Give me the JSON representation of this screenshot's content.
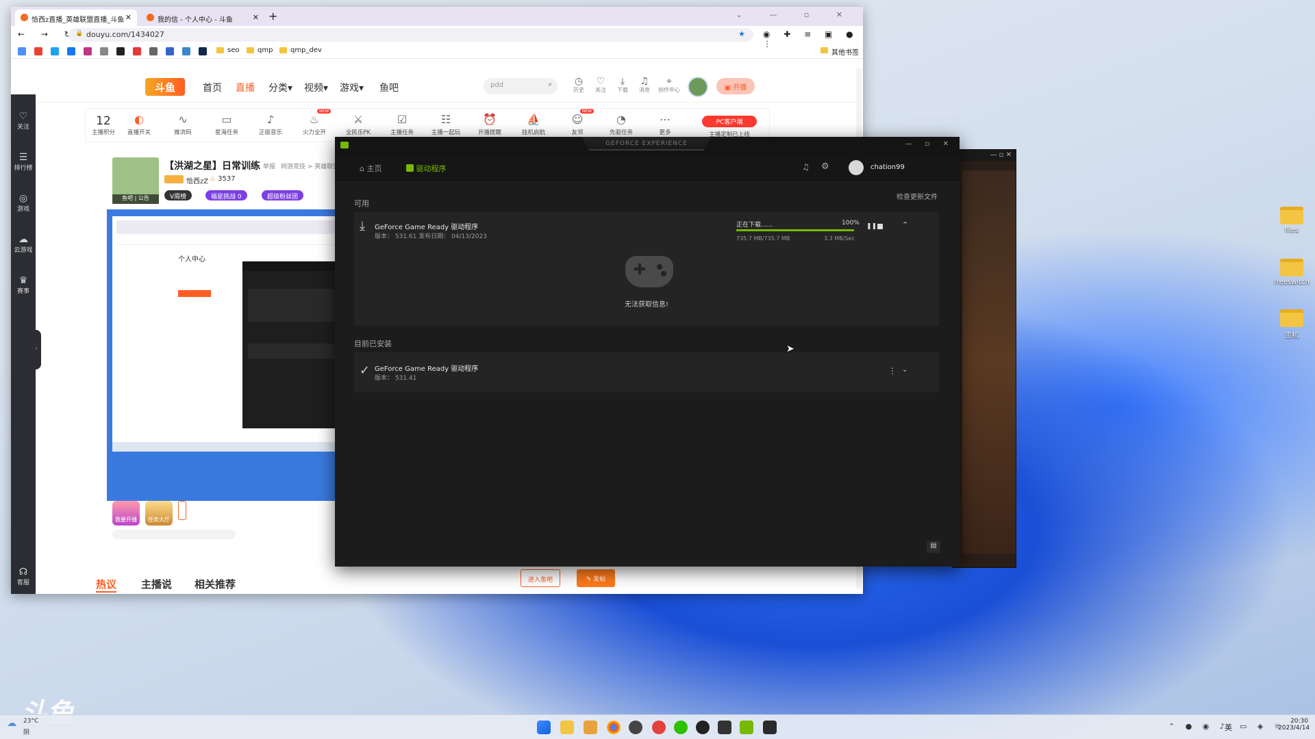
{
  "desktop": {
    "icons": [
      {
        "label": "files"
      },
      {
        "label": "freeswitch"
      },
      {
        "label": "主机"
      }
    ],
    "watermark": "斗鱼"
  },
  "taskbar": {
    "weather_temp": "23°C",
    "weather_text": "阴",
    "time": "20:30",
    "date": "2023/4/14",
    "ime": "英"
  },
  "browser": {
    "tabs": [
      {
        "title": "恰西z直播_英雄联盟直播_斗鱼"
      },
      {
        "title": "我的信 - 个人中心 - 斗鱼"
      }
    ],
    "new_tab": "+",
    "url": "douyu.com/1434027",
    "bookmarks": [
      "seo",
      "qmp",
      "qmp_dev"
    ],
    "other_bookmarks": "其他书签"
  },
  "douyu": {
    "logo": "斗鱼",
    "nav": [
      "首页",
      "直播",
      "分类",
      "视频",
      "游戏",
      "鱼吧"
    ],
    "search_value": "pdd",
    "header_icons": [
      {
        "label": "历史",
        "icon": "clock-icon"
      },
      {
        "label": "关注",
        "icon": "heart-icon"
      },
      {
        "label": "下载",
        "icon": "download-icon"
      },
      {
        "label": "消息",
        "icon": "bell-icon"
      },
      {
        "label": "创作中心",
        "icon": "pin-icon"
      }
    ],
    "kaibo": "开播",
    "rail": [
      {
        "label": "关注",
        "icon": "heart-icon"
      },
      {
        "label": "排行榜",
        "icon": "list-icon"
      },
      {
        "label": "游戏",
        "icon": "gamepad-icon"
      },
      {
        "label": "云游戏",
        "icon": "cloud-icon"
      },
      {
        "label": "赛事",
        "icon": "trophy-icon"
      },
      {
        "label": "客服",
        "icon": "headset-icon"
      }
    ],
    "points_value": "12",
    "points_label": "主播积分",
    "tools": [
      {
        "label": "直播开关"
      },
      {
        "label": "推流码"
      },
      {
        "label": "星海任务"
      },
      {
        "label": "正版音乐"
      },
      {
        "label": "火力全开",
        "badge": "NEW"
      },
      {
        "label": "全民乐PK"
      },
      {
        "label": "主播任务"
      },
      {
        "label": "主播一起玩"
      },
      {
        "label": "开播提醒"
      },
      {
        "label": "挂机启航"
      },
      {
        "label": "友邻",
        "badge": "NEW"
      },
      {
        "label": "先驱任务"
      },
      {
        "label": "更多"
      }
    ],
    "pc_client": "PC客户端",
    "pc_client_sub": "主播定制已上线",
    "room_title": "【洪湖之星】日常训练",
    "report": "举报",
    "room_category": "网游竞技 > 英雄联盟",
    "streamer": "恰西zZ",
    "hot": "3537",
    "avatar_tags": "鱼吧 | 公告",
    "badges": [
      "V周榜",
      "福星挑战 0",
      "超级粉丝团"
    ],
    "mini_page_title": "个人中心",
    "bottom_tabs": [
      "热议",
      "主播说",
      "相关推荐"
    ],
    "enter_fishbar": "进入鱼吧",
    "post": "发帖",
    "activity_labels": [
      "我要开播",
      "任务大厅"
    ]
  },
  "gfe": {
    "title": "GEFORCE EXPERIENCE",
    "nav_home": "主页",
    "nav_drivers": "驱动程序",
    "username": "chation99",
    "available_label": "可用",
    "check_updates": "检查更新文件",
    "driver_name": "GeForce Game Ready 驱动程序",
    "driver_meta": "版本： 531.61   发布日期： 04/13/2023",
    "download_status": "正在下载......",
    "progress_percent": "100%",
    "progress_fraction": 1.0,
    "download_size": "735.7 MB/735.7 MB",
    "download_speed": "3.3 MB/Sec",
    "no_info": "无法获取信息!",
    "installed_label": "目前已安装",
    "installed_name": "GeForce Game Ready 驱动程序",
    "installed_version": "版本： 531.41"
  }
}
